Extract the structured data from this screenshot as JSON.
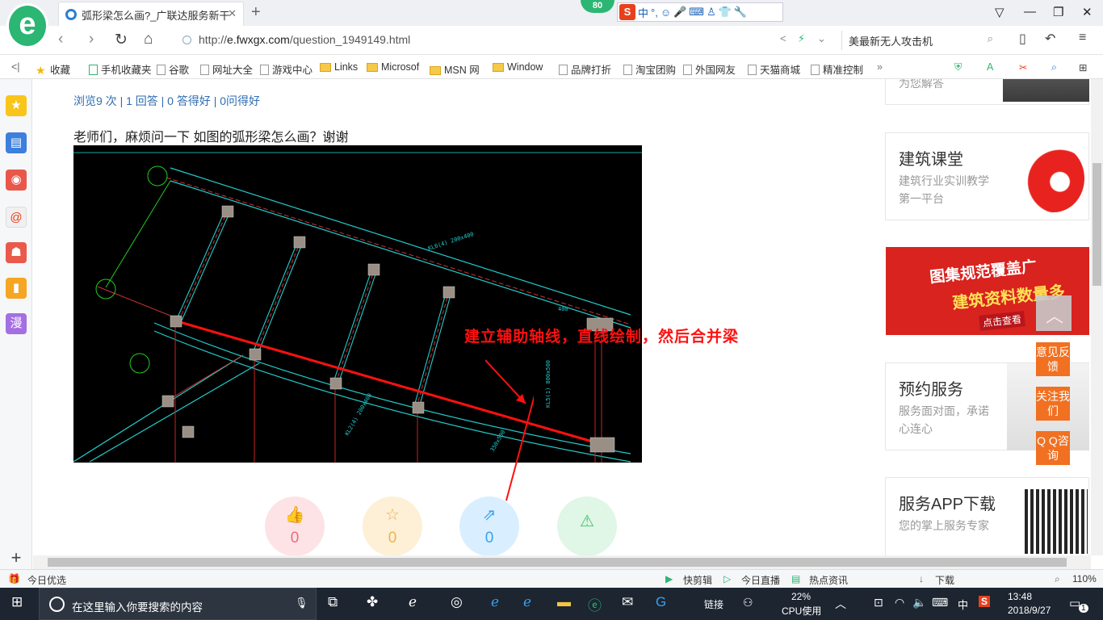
{
  "tab": {
    "title": "弧形梁怎么画?_广联达服务新干"
  },
  "score": "80",
  "ime": {
    "lang": "中",
    "punct": "°,"
  },
  "nav": {
    "url_prefix": "http://",
    "url_domain": "e.fwxgx.com",
    "url_path": "/question_1949149.html",
    "search_text": "美最新无人攻击机"
  },
  "bookmarks": [
    {
      "label": "收藏",
      "icon": "star"
    },
    {
      "label": "手机收藏夹",
      "icon": "phone"
    },
    {
      "label": "谷歌",
      "icon": "page"
    },
    {
      "label": "网址大全",
      "icon": "page"
    },
    {
      "label": "游戏中心",
      "icon": "page"
    },
    {
      "label": "Links",
      "icon": "folder"
    },
    {
      "label": "Microsof",
      "icon": "folder"
    },
    {
      "label": "MSN 网",
      "icon": "folder"
    },
    {
      "label": "Window",
      "icon": "folder"
    },
    {
      "label": "品牌打折",
      "icon": "page"
    },
    {
      "label": "淘宝团购",
      "icon": "page"
    },
    {
      "label": "外国网友",
      "icon": "page"
    },
    {
      "label": "天猫商城",
      "icon": "page"
    },
    {
      "label": "精准控制",
      "icon": "page"
    }
  ],
  "sidebar_manga": "漫",
  "question": {
    "stats": "浏览9 次 | 1 回答 | 0 答得好 | 0问得好",
    "text": "老师们，麻烦问一下 如图的弧形梁怎么画？谢谢",
    "annotation": "建立辅助轴线，直线绘制，然后合并梁"
  },
  "actions": [
    {
      "name": "like",
      "count": "0",
      "icon": "thumbs-up-icon",
      "bg": "#fde3e6",
      "color": "#ef6b7b"
    },
    {
      "name": "favorite",
      "count": "0",
      "icon": "star-icon",
      "bg": "#fdf0d6",
      "color": "#f0b24a"
    },
    {
      "name": "share",
      "count": "0",
      "icon": "share-icon",
      "bg": "#d9efff",
      "color": "#3aa0ee"
    },
    {
      "name": "report",
      "count": "",
      "icon": "warning-icon",
      "bg": "#e0f6e6",
      "color": "#3cc46a"
    }
  ],
  "sidebar_cards": {
    "top_partial": "为您解答",
    "course": {
      "title": "建筑课堂",
      "desc": "建筑行业实训教学第一平台"
    },
    "ad": {
      "line1": "图集规范覆盖广",
      "line2": "建筑资料数量多",
      "cta": "点击查看"
    },
    "booking": {
      "title": "预约服务",
      "desc": "服务面对面，承诺心连心"
    },
    "app": {
      "title": "服务APP下载",
      "desc": "您的掌上服务专家"
    }
  },
  "float_buttons": [
    "意见反馈",
    "关注我们",
    "Q Q咨询"
  ],
  "status": {
    "left": "今日优选",
    "items": [
      "快剪辑",
      "今日直播",
      "热点资讯",
      "下载"
    ],
    "zoom": "110%"
  },
  "taskbar": {
    "search_placeholder": "在这里输入你要搜索的内容",
    "links": "链接",
    "cpu_pct": "22%",
    "cpu_label": "CPU使用",
    "ime": "中",
    "time": "13:48",
    "date": "2018/9/27",
    "notif": "1"
  }
}
